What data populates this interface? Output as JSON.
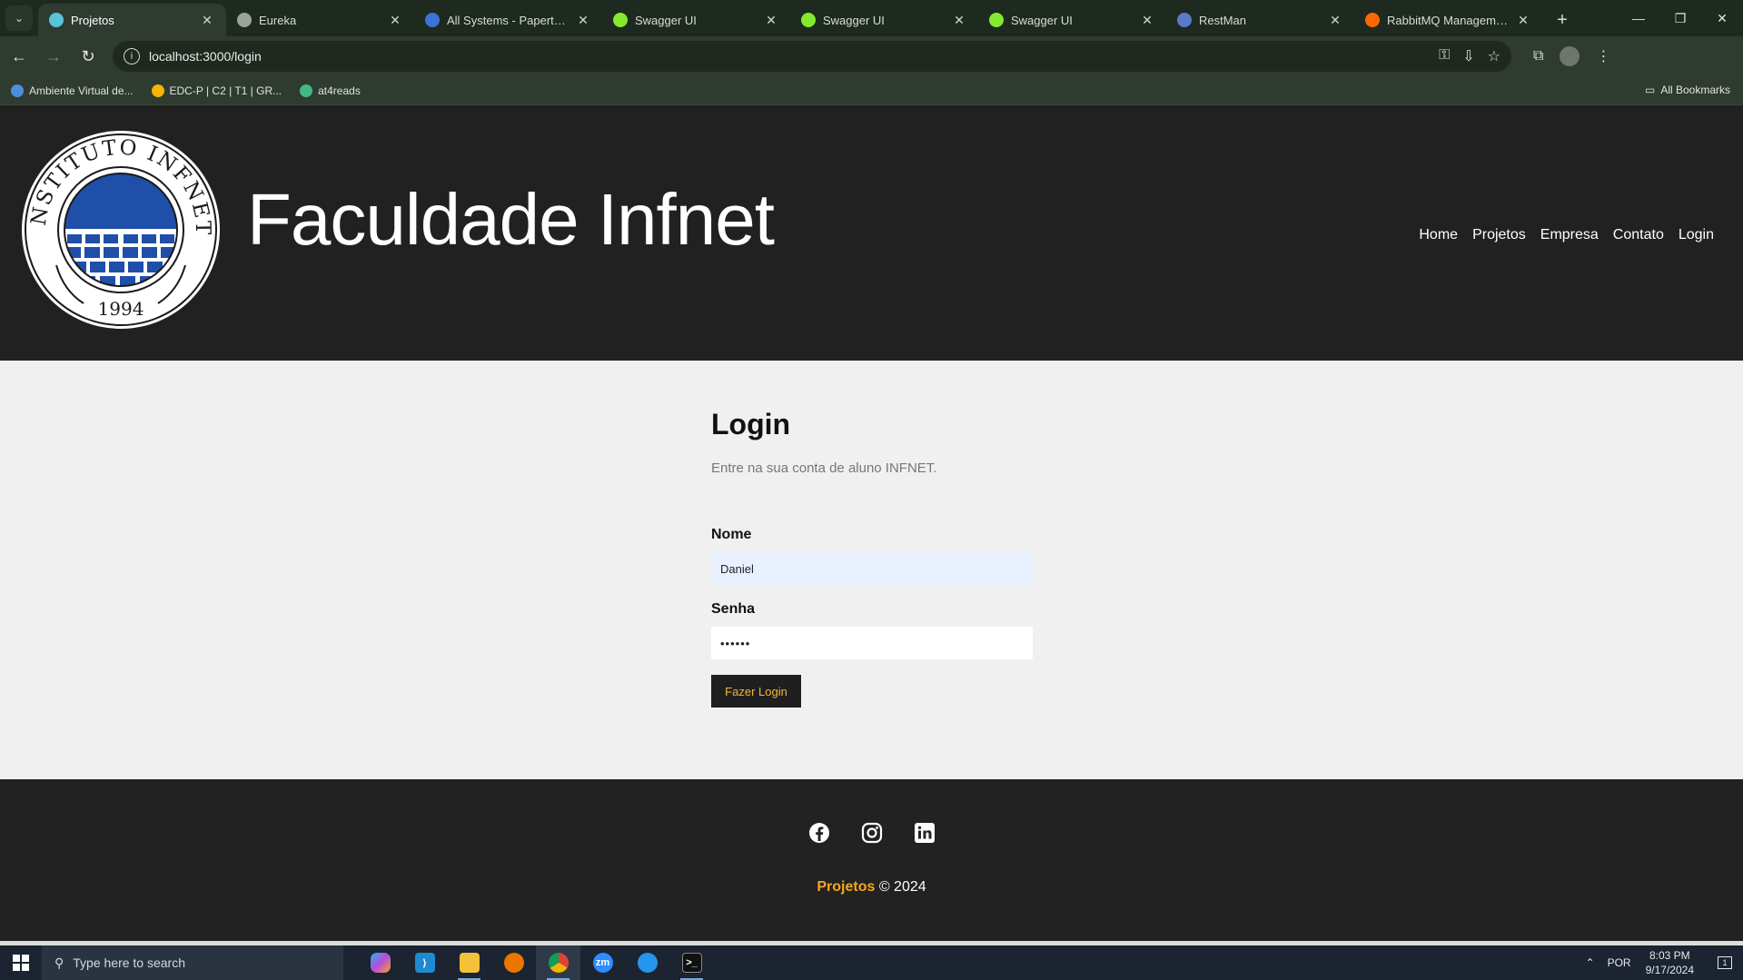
{
  "browser": {
    "tabs": [
      {
        "title": "Projetos",
        "icon": "react-icon",
        "color": "#58c4dc",
        "active": true
      },
      {
        "title": "Eureka",
        "icon": "globe-icon",
        "color": "#9aa49a",
        "active": false
      },
      {
        "title": "All Systems - Papertrail",
        "icon": "papertrail-icon",
        "color": "#3b73d9",
        "active": false
      },
      {
        "title": "Swagger UI",
        "icon": "swagger-icon",
        "color": "#85ea2d",
        "active": false
      },
      {
        "title": "Swagger UI",
        "icon": "swagger-icon",
        "color": "#85ea2d",
        "active": false
      },
      {
        "title": "Swagger UI",
        "icon": "swagger-icon",
        "color": "#85ea2d",
        "active": false
      },
      {
        "title": "RestMan",
        "icon": "restman-icon",
        "color": "#5a7ac9",
        "active": false
      },
      {
        "title": "RabbitMQ Management",
        "icon": "rabbitmq-icon",
        "color": "#ff6600",
        "active": false
      }
    ],
    "url": "localhost:3000/login",
    "bookmarks": [
      {
        "label": "Ambiente Virtual de...",
        "icon": "moodle-icon",
        "color": "#4a90d9"
      },
      {
        "label": "EDC-P | C2 | T1 | GR...",
        "icon": "drive-icon",
        "color": "#f4b400"
      },
      {
        "label": "at4reads",
        "icon": "vue-icon",
        "color": "#42b883"
      }
    ],
    "all_bookmarks_label": "All Bookmarks"
  },
  "site": {
    "brand": "Faculdade Infnet",
    "seal": {
      "top_text": "INSTITUTO INFNET",
      "year": "1994"
    },
    "nav": [
      "Home",
      "Projetos",
      "Empresa",
      "Contato",
      "Login"
    ]
  },
  "login": {
    "title": "Login",
    "subtitle": "Entre na sua conta de aluno INFNET.",
    "name_label": "Nome",
    "name_value": "Daniel",
    "password_label": "Senha",
    "password_value": "••••••",
    "button_label": "Fazer Login"
  },
  "footer": {
    "social": [
      "facebook-icon",
      "instagram-icon",
      "linkedin-icon"
    ],
    "brand": "Projetos",
    "copyright": "© 2024"
  },
  "taskbar": {
    "search_placeholder": "Type here to search",
    "apps": [
      "copilot-icon",
      "vscode-icon",
      "file-explorer-icon",
      "blender-icon",
      "chrome-icon",
      "zoom-icon",
      "docker-icon",
      "terminal-icon"
    ],
    "language": "POR",
    "time": "8:03 PM",
    "date": "9/17/2024",
    "notification_count": "1"
  },
  "colors": {
    "header_bg": "#212121",
    "accent": "#f5a623",
    "seal_blue": "#1f4fa8"
  }
}
